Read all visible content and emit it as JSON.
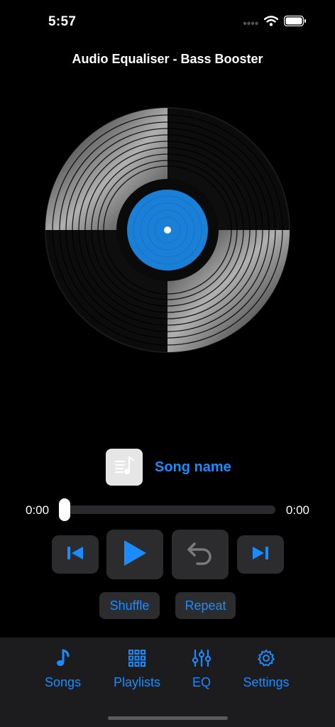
{
  "status": {
    "time": "5:57"
  },
  "app": {
    "title": "Audio Equaliser - Bass Booster"
  },
  "player": {
    "song_name": "Song name",
    "elapsed": "0:00",
    "duration": "0:00",
    "progress": 0,
    "shuffle_label": "Shuffle",
    "repeat_label": "Repeat"
  },
  "icons": {
    "previous": "skip-previous-icon",
    "play": "play-icon",
    "undo": "undo-icon",
    "next": "skip-next-icon",
    "songs": "music-note-icon",
    "playlists": "grid-icon",
    "eq": "sliders-icon",
    "settings": "gear-icon"
  },
  "tabs": [
    {
      "label": "Songs"
    },
    {
      "label": "Playlists"
    },
    {
      "label": "EQ"
    },
    {
      "label": "Settings"
    }
  ],
  "colors": {
    "accent": "#1a8cff",
    "background": "#000000",
    "control_bg": "#2c2c2e",
    "tab_bar_bg": "#1c1c1e"
  }
}
